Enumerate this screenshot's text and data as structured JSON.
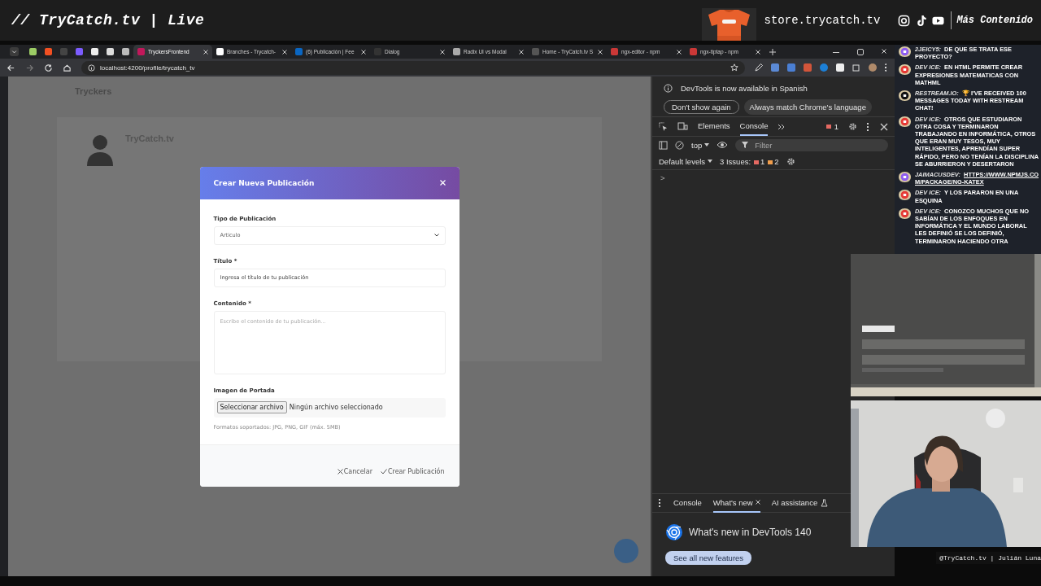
{
  "stream_header": {
    "title": "// TryCatch.tv | Live",
    "store": "store.trycatch.tv",
    "more": "Más Contenido"
  },
  "browser": {
    "tabs": [
      {
        "selected": false,
        "color": "#9ccc65"
      },
      {
        "selected": false,
        "color": "#f25022"
      },
      {
        "selected": false,
        "color": "#444444"
      },
      {
        "selected": false,
        "color": "#7c5cff"
      },
      {
        "selected": false,
        "color": "#eeeeee"
      },
      {
        "selected": false,
        "color": "#dddddd"
      },
      {
        "selected": false,
        "color": "#bbbbbb"
      },
      {
        "label": "TryckersFrontend",
        "selected": true,
        "color": "#c2185b"
      },
      {
        "label": "Branches - Trycatch-",
        "selected": false,
        "color": "#ffffff"
      },
      {
        "label": "(6) Publicación | Fee",
        "selected": false,
        "color": "#0a66c2"
      },
      {
        "label": "Dialog",
        "selected": false,
        "color": "#333333"
      },
      {
        "label": "Radix UI vs Modal",
        "selected": false,
        "color": "#aaaaaa"
      },
      {
        "label": "Home - TryCatch.tv S",
        "selected": false,
        "color": "#555555"
      },
      {
        "label": "ngx-editor - npm",
        "selected": false,
        "color": "#cb3837"
      },
      {
        "label": "ngx-tiptap - npm",
        "selected": false,
        "color": "#cb3837"
      }
    ],
    "address": "localhost:4200/profile/trycatch_tv"
  },
  "page": {
    "brand": "Tryckers",
    "profile_name": "TryCatch.tv"
  },
  "modal": {
    "title": "Crear Nueva Publicación",
    "type_label": "Tipo de Publicación",
    "type_value": "Articulo",
    "title_label": "Título *",
    "title_value": "Ingresa el título de tu publicación",
    "content_label": "Contenido *",
    "content_placeholder": "Escribe el contenido de tu publicación...",
    "image_label": "Imagen de Portada",
    "file_button": "Seleccionar archivo",
    "file_status": "Ningún archivo seleccionado",
    "hint": "Formatos soportados: JPG, PNG, GIF (máx. 5MB)",
    "cancel": "Cancelar",
    "submit": "Crear Publicación"
  },
  "devtools": {
    "notice": "DevTools is now available in Spanish",
    "notice_buttons": [
      "Don't show again",
      "Always match Chrome's language"
    ],
    "tabs": [
      {
        "label": "Elements",
        "selected": false
      },
      {
        "label": "Console",
        "selected": true
      }
    ],
    "error_count": "1",
    "context": "top",
    "filter_placeholder": "Filter",
    "levels": "Default levels",
    "issues": "3 Issues:",
    "issue_errors": "1",
    "issue_warnings": "2",
    "prompt": ">",
    "drawer_tabs": [
      {
        "label": "Console",
        "selected": false
      },
      {
        "label": "What's new",
        "selected": true
      },
      {
        "label": "AI assistance",
        "selected": false
      }
    ],
    "whats_new_title": "What's new in DevTools 140",
    "whats_new_button": "See all new features"
  },
  "chat": {
    "messages": [
      {
        "kind": "twitch",
        "user": "2JEICY5:",
        "text": "DE QUE SE TRATA ESE PROYECTO?",
        "link": false
      },
      {
        "kind": "youtube",
        "user": "DEV ICE:",
        "text": "EN HTML PERMITE CREAR EXPRESIONES MATEMATICAS CON MATHML",
        "link": false
      },
      {
        "kind": "restream",
        "user": "RESTREAM.IO:",
        "text": "🏆 I'VE RECEIVED 100 MESSAGES TODAY WITH RESTREAM CHAT!",
        "link": false
      },
      {
        "kind": "youtube",
        "user": "DEV ICE:",
        "text": "OTROS QUE ESTUDIARON OTRA COSA Y TERMINARON TRABAJANDO EN INFORMÁTICA, OTROS QUE ERAN MUY TESOS, MUY INTELIGENTES, APRENDÍAN SUPER RÁPIDO, PERO NO TENÍAN LA DISCIPLINA SE ABURRIERON Y DESERTARON",
        "link": false
      },
      {
        "kind": "twitch",
        "user": "JAIMACUSDEV:",
        "text": "HTTPS://WWW.NPMJS.COM/PACKAGE/NG-KATEX",
        "link": true
      },
      {
        "kind": "youtube",
        "user": "DEV ICE:",
        "text": "Y LOS PARARON EN UNA ESQUINA",
        "link": false
      },
      {
        "kind": "youtube",
        "user": "DEV ICE:",
        "text": "CONOZCO MUCHOS QUE NO SABÍAN DE LOS ENFOQUES EN INFORMÁTICA Y EL MUNDO LABORAL LES DEFINIÓ SE LOS DEFINIÓ, TERMINARON HACIENDO OTRA",
        "link": false
      }
    ]
  },
  "overlay_tag": "@TryCatch.tv | Julián Luna"
}
